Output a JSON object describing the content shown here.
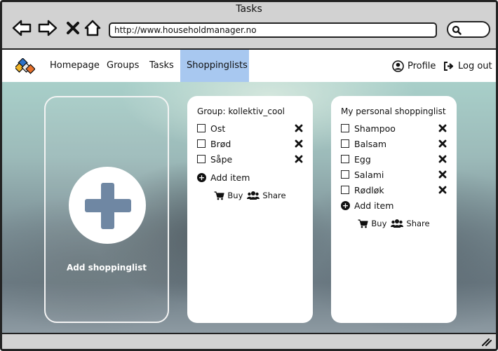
{
  "window": {
    "title": "Tasks"
  },
  "browser": {
    "url": "http://www.householdmanager.no"
  },
  "nav": {
    "items": [
      "Homepage",
      "Groups",
      "Tasks",
      "Shoppinglists"
    ],
    "profile": "Profile",
    "logout": "Log out"
  },
  "add_card": {
    "label": "Add shoppinglist"
  },
  "group_list": {
    "title": "Group: kollektiv_cool",
    "items": [
      "Ost",
      "Brød",
      "Såpe"
    ],
    "add_item": "Add item",
    "buy": "Buy",
    "share": "Share"
  },
  "personal_list": {
    "title": "My personal shoppinglist",
    "items": [
      "Shampoo",
      "Balsam",
      "Egg",
      "Salami",
      "Rødløk"
    ],
    "add_item": "Add item",
    "buy": "Buy",
    "share": "Share"
  },
  "colors": {
    "active_tab": "#a8c8f0",
    "plus_icon": "#6f87a3"
  }
}
